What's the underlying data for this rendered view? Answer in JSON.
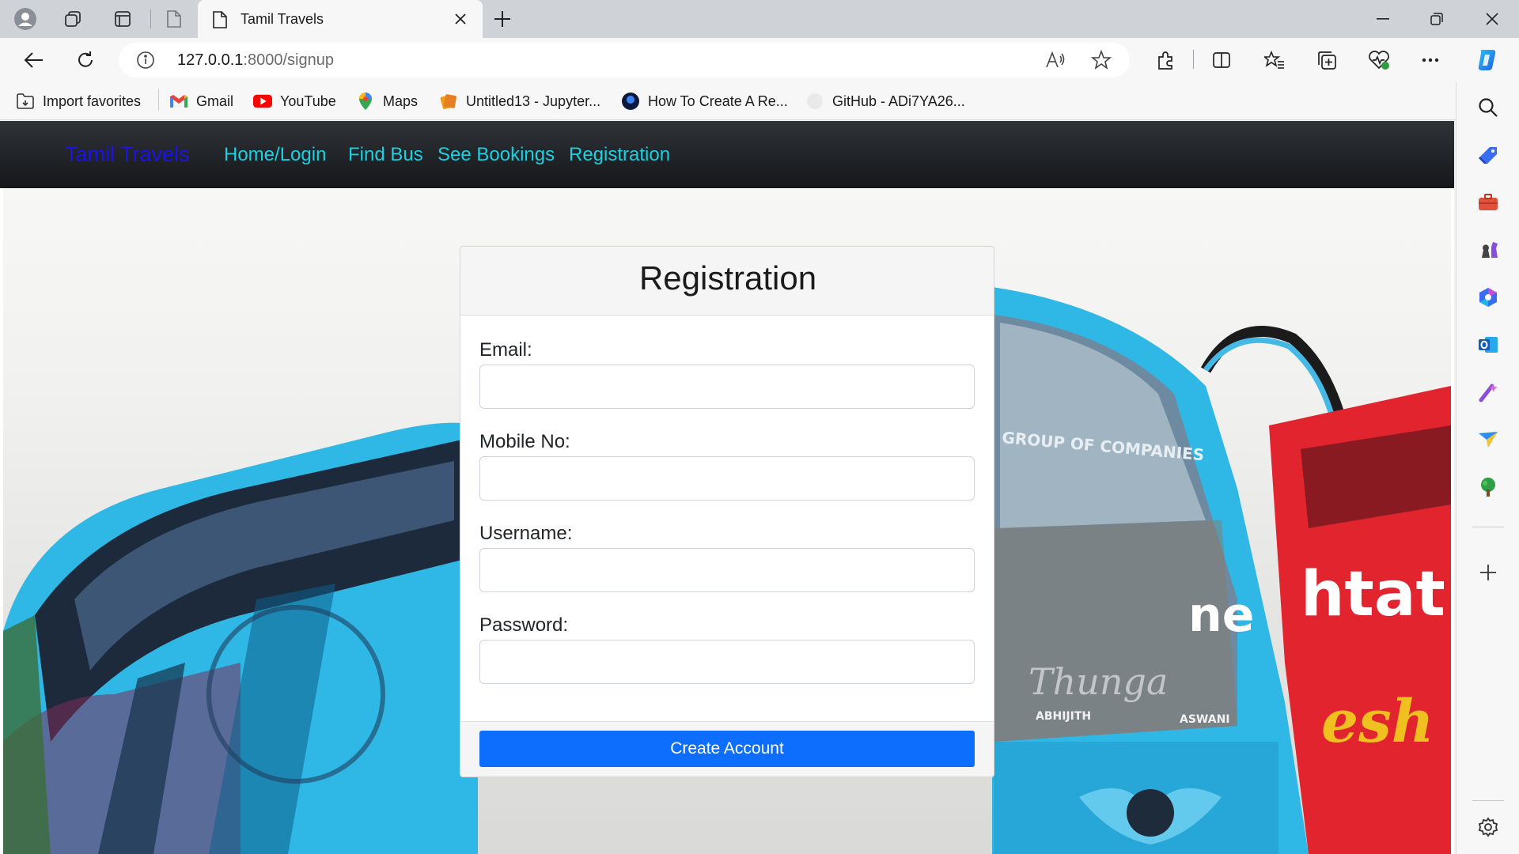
{
  "browser": {
    "tab": {
      "title": "Tamil Travels"
    },
    "address": {
      "host": "127.0.0.1",
      "path": ":8000/signup"
    },
    "favorites": [
      {
        "label": "Import favorites",
        "icon": "import-icon"
      },
      {
        "label": "Gmail",
        "icon": "gmail-icon"
      },
      {
        "label": "YouTube",
        "icon": "youtube-icon"
      },
      {
        "label": "Maps",
        "icon": "maps-icon"
      },
      {
        "label": "Untitled13 - Jupyter...",
        "icon": "jupyter-icon"
      },
      {
        "label": "How To Create A Re...",
        "icon": "site-icon"
      },
      {
        "label": "GitHub - ADi7YA26...",
        "icon": "github-icon"
      }
    ]
  },
  "site": {
    "brand": "Tamil Travels",
    "nav": [
      "Home/Login",
      "Find Bus",
      "See Bookings",
      "Registration"
    ]
  },
  "form": {
    "title": "Registration",
    "fields": [
      {
        "label": "Email:",
        "value": "",
        "placeholder": ""
      },
      {
        "label": "Mobile No:",
        "value": "",
        "placeholder": ""
      },
      {
        "label": "Username:",
        "value": "",
        "placeholder": ""
      },
      {
        "label": "Password:",
        "value": "",
        "placeholder": ""
      }
    ],
    "submit_label": "Create Account"
  },
  "background_photo": {
    "texts": [
      "GROUP OF COMPANIES",
      "ABHIJITH",
      "ASWANI",
      "Thunga",
      "htat.",
      "nesh",
      "ne"
    ]
  },
  "colors": {
    "brand": "#1b12e8",
    "nav_link": "#19d1e0",
    "button": "#0d6efd",
    "navbar": "#212529"
  }
}
